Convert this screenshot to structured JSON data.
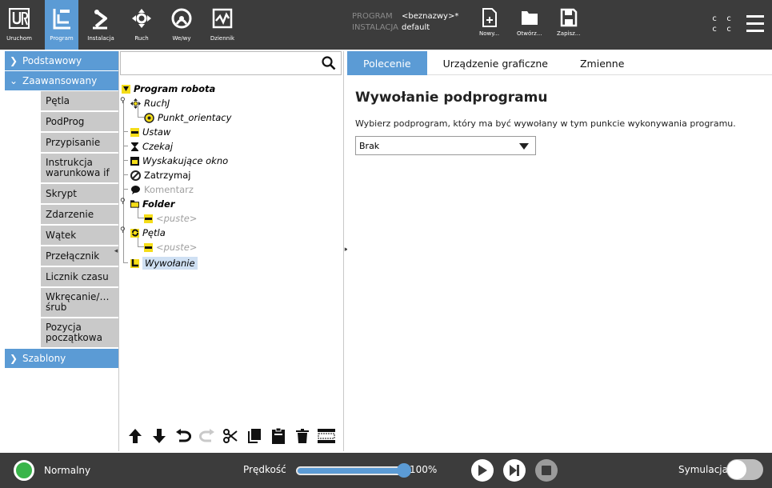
{
  "topbar": {
    "tabs": [
      {
        "label": "Uruchom"
      },
      {
        "label": "Program"
      },
      {
        "label": "Instalacja"
      },
      {
        "label": "Ruch"
      },
      {
        "label": "We/wy"
      },
      {
        "label": "Dziennik"
      }
    ],
    "program_key": "PROGRAM",
    "program_value": "<beznazwy>*",
    "install_key": "INSTALACJA",
    "install_value": "default",
    "new_label": "Nowy...",
    "open_label": "Otwórz...",
    "save_label": "Zapisz...",
    "cc_row1": "c c",
    "cc_row2": "c c"
  },
  "palette": {
    "categories": [
      {
        "label": "Podstawowy"
      },
      {
        "label": "Zaawansowany"
      },
      {
        "label": "Szablony"
      }
    ],
    "advanced_items": [
      {
        "label": "Pętla"
      },
      {
        "label": "PodProg"
      },
      {
        "label": "Przypisanie"
      },
      {
        "label": "Instrukcja warunkowa if"
      },
      {
        "label": "Skrypt"
      },
      {
        "label": "Zdarzenie"
      },
      {
        "label": "Wątek"
      },
      {
        "label": "Przełącznik"
      },
      {
        "label": "Licznik czasu"
      },
      {
        "label": "Wkręcanie/… śrub"
      },
      {
        "label": "Pozycja początkowa"
      }
    ]
  },
  "tree": {
    "search_placeholder": "",
    "nodes": [
      {
        "label": "Program robota"
      },
      {
        "label": "RuchJ"
      },
      {
        "label": "Punkt_orientacy"
      },
      {
        "label": "Ustaw"
      },
      {
        "label": "Czekaj"
      },
      {
        "label": "Wyskakujące okno"
      },
      {
        "label": "Zatrzymaj"
      },
      {
        "label": "Komentarz"
      },
      {
        "label": "Folder"
      },
      {
        "label": "<puste>"
      },
      {
        "label": "Pętla"
      },
      {
        "label": "<puste>"
      },
      {
        "label": "Wywołanie"
      }
    ]
  },
  "right": {
    "tabs": [
      {
        "label": "Polecenie"
      },
      {
        "label": "Urządzenie graficzne"
      },
      {
        "label": "Zmienne"
      }
    ],
    "title": "Wywołanie podprogramu",
    "description": "Wybierz podprogram, który ma być wywołany w tym punkcie wykonywania programu.",
    "dropdown_value": "Brak"
  },
  "bottombar": {
    "status": "Normalny",
    "speed_label": "Prędkość",
    "speed_value": "100%",
    "speed_fraction": 1.0,
    "simulation_label": "Symulacja"
  },
  "colors": {
    "accent": "#5b9bd5",
    "topbar": "#3c3c3c",
    "status_ok": "#39b54a",
    "node_tag": "#f5dd18"
  }
}
